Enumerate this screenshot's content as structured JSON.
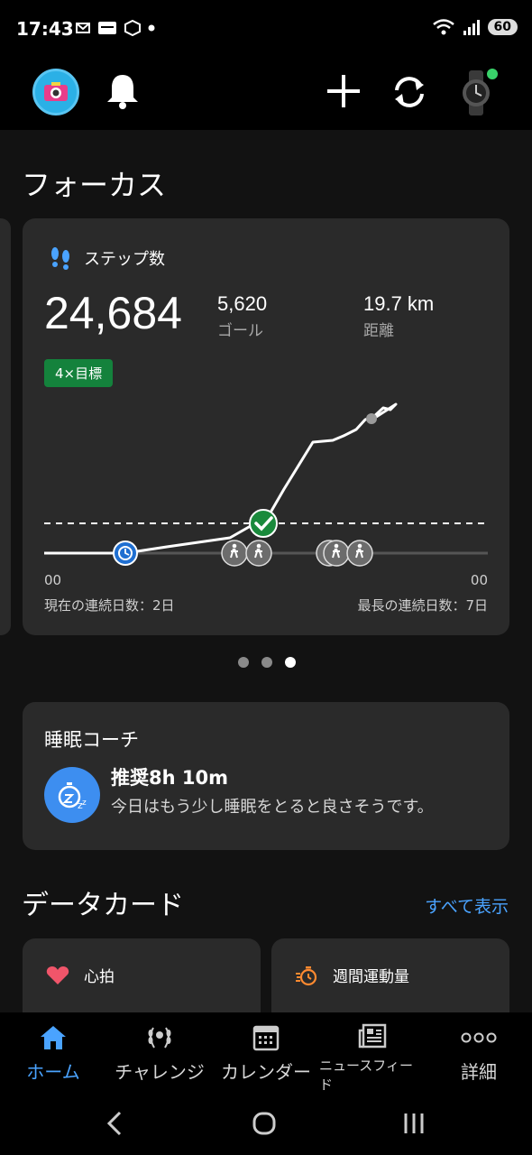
{
  "status": {
    "time": "17:43",
    "battery": "60"
  },
  "focus": {
    "title": "フォーカス"
  },
  "steps": {
    "label": "ステップ数",
    "value": "24,684",
    "goal_value": "5,620",
    "goal_label": "ゴール",
    "distance_value": "19.7 km",
    "distance_label": "距離",
    "badge": "4×目標",
    "axis_start": "00",
    "axis_end": "00",
    "current_streak": "現在の連続日数：2日",
    "longest_streak": "最長の連続日数：7日"
  },
  "carousel": {
    "count": 3,
    "active": 3
  },
  "sleep": {
    "title": "睡眠コーチ",
    "recommendation": "推奨8h 10m",
    "description": "今日はもう少し睡眠をとると良さそうです。"
  },
  "data_cards": {
    "title": "データカード",
    "see_all": "すべて表示",
    "cards": [
      {
        "label": "心拍",
        "icon": "heart-icon"
      },
      {
        "label": "週間運動量",
        "icon": "stopwatch-icon"
      }
    ]
  },
  "nav": [
    {
      "label": "ホーム",
      "icon": "home-icon"
    },
    {
      "label": "チャレンジ",
      "icon": "laurel-icon"
    },
    {
      "label": "カレンダー",
      "icon": "calendar-icon"
    },
    {
      "label": "ニュースフィード",
      "icon": "newsfeed-icon"
    },
    {
      "label": "詳細",
      "icon": "more-icon"
    }
  ],
  "colors": {
    "accent": "#4aa3ff",
    "goal_badge": "#14823c",
    "check": "#1a8a3c",
    "timer": "#1f6fd1"
  }
}
